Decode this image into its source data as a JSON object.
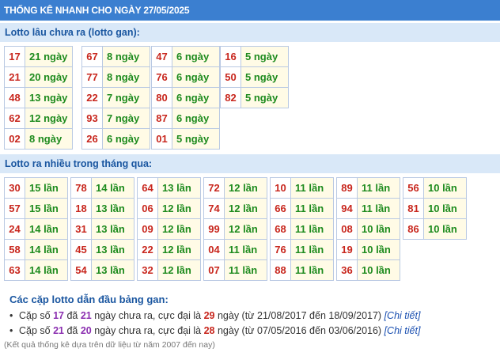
{
  "header": {
    "title": "THỐNG KÊ NHANH CHO NGÀY 27/05/2025"
  },
  "gan_section": {
    "title": "Lotto lâu chưa ra (lotto gan):",
    "columns": [
      [
        {
          "num": "17",
          "val": "21 ngày"
        },
        {
          "num": "21",
          "val": "20 ngày"
        },
        {
          "num": "48",
          "val": "13 ngày"
        },
        {
          "num": "62",
          "val": "12 ngày"
        },
        {
          "num": "02",
          "val": "8 ngày"
        }
      ],
      [
        {
          "num": "67",
          "val": "8 ngày"
        },
        {
          "num": "77",
          "val": "8 ngày"
        },
        {
          "num": "22",
          "val": "7 ngày"
        },
        {
          "num": "93",
          "val": "7 ngày"
        },
        {
          "num": "26",
          "val": "6 ngày"
        }
      ],
      [
        {
          "num": "47",
          "val": "6 ngày"
        },
        {
          "num": "76",
          "val": "6 ngày"
        },
        {
          "num": "80",
          "val": "6 ngày"
        },
        {
          "num": "87",
          "val": "6 ngày"
        },
        {
          "num": "01",
          "val": "5 ngày"
        }
      ],
      [
        {
          "num": "16",
          "val": "5 ngày"
        },
        {
          "num": "50",
          "val": "5 ngày"
        },
        {
          "num": "82",
          "val": "5 ngày"
        }
      ]
    ]
  },
  "freq_section": {
    "title": "Lotto ra nhiều trong tháng qua:",
    "columns": [
      [
        {
          "num": "30",
          "val": "15 lần"
        },
        {
          "num": "57",
          "val": "15 lần"
        },
        {
          "num": "24",
          "val": "14 lần"
        },
        {
          "num": "58",
          "val": "14 lần"
        },
        {
          "num": "63",
          "val": "14 lần"
        }
      ],
      [
        {
          "num": "78",
          "val": "14 lần"
        },
        {
          "num": "18",
          "val": "13 lần"
        },
        {
          "num": "31",
          "val": "13 lần"
        },
        {
          "num": "45",
          "val": "13 lần"
        },
        {
          "num": "54",
          "val": "13 lần"
        }
      ],
      [
        {
          "num": "64",
          "val": "13 lần"
        },
        {
          "num": "06",
          "val": "12 lần"
        },
        {
          "num": "09",
          "val": "12 lần"
        },
        {
          "num": "22",
          "val": "12 lần"
        },
        {
          "num": "32",
          "val": "12 lần"
        }
      ],
      [
        {
          "num": "72",
          "val": "12 lần"
        },
        {
          "num": "74",
          "val": "12 lần"
        },
        {
          "num": "99",
          "val": "12 lần"
        },
        {
          "num": "04",
          "val": "11 lần"
        },
        {
          "num": "07",
          "val": "11 lần"
        }
      ],
      [
        {
          "num": "10",
          "val": "11 lần"
        },
        {
          "num": "66",
          "val": "11 lần"
        },
        {
          "num": "68",
          "val": "11 lần"
        },
        {
          "num": "76",
          "val": "11 lần"
        },
        {
          "num": "88",
          "val": "11 lần"
        }
      ],
      [
        {
          "num": "89",
          "val": "11 lần"
        },
        {
          "num": "94",
          "val": "11 lần"
        },
        {
          "num": "08",
          "val": "10 lần"
        },
        {
          "num": "19",
          "val": "10 lần"
        },
        {
          "num": "36",
          "val": "10 lần"
        }
      ],
      [
        {
          "num": "56",
          "val": "10 lần"
        },
        {
          "num": "81",
          "val": "10 lần"
        },
        {
          "num": "86",
          "val": "10 lần"
        }
      ]
    ]
  },
  "pairs": {
    "title": "Các cặp lotto dẫn đầu bảng gan:",
    "items": [
      {
        "prefix": "Cặp số ",
        "pair": "17",
        "mid1": " đã ",
        "days": "21",
        "mid2": " ngày chưa ra, cực đại là ",
        "max": "29",
        "suffix": " ngày (từ 21/08/2017 đến 18/09/2017) ",
        "link": "[Chi tiết]"
      },
      {
        "prefix": "Cặp số ",
        "pair": "21",
        "mid1": " đã ",
        "days": "20",
        "mid2": " ngày chưa ra, cực đại là ",
        "max": "28",
        "suffix": " ngày (từ 07/05/2016 đến 03/06/2016) ",
        "link": "[Chi tiết]"
      }
    ]
  },
  "footnote": "(Kết quả thống kê dựa trên dữ liệu từ năm 2007 đến nay)",
  "colors": {
    "header_bg": "#3b7fd0",
    "section_bg": "#d9e8f8",
    "number": "#c8261d",
    "value": "#1e8b1e",
    "value_bg": "#fffbe6"
  }
}
